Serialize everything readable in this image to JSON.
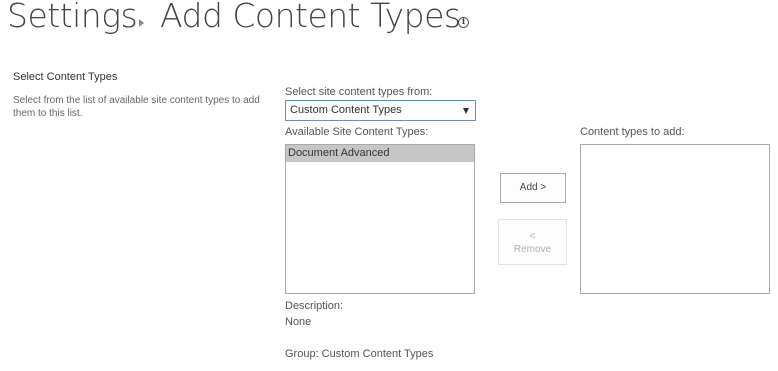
{
  "header": {
    "breadcrumb_root": "Settings",
    "page_title": "Add Content Types"
  },
  "section": {
    "title": "Select Content Types",
    "description": "Select from the list of available site content types to add them to this list."
  },
  "source_select": {
    "label": "Select site content types from:",
    "selected": "Custom Content Types"
  },
  "available": {
    "label": "Available Site Content Types:",
    "items": [
      "Document Advanced"
    ]
  },
  "to_add": {
    "label": "Content types to add:",
    "items": []
  },
  "buttons": {
    "add": "Add >",
    "remove_arrow": "<",
    "remove": "Remove"
  },
  "details": {
    "description_label": "Description:",
    "description_value": "None",
    "group": "Group: Custom Content Types"
  },
  "colors": {
    "accent_border": "#6a8fc8",
    "selected_item_bg": "#c6c6c6",
    "disabled_text": "#b1b1b1"
  },
  "icons": {
    "info": "info-icon",
    "breadcrumb_separator": "chevron-right-icon",
    "dropdown": "chevron-down-icon"
  }
}
